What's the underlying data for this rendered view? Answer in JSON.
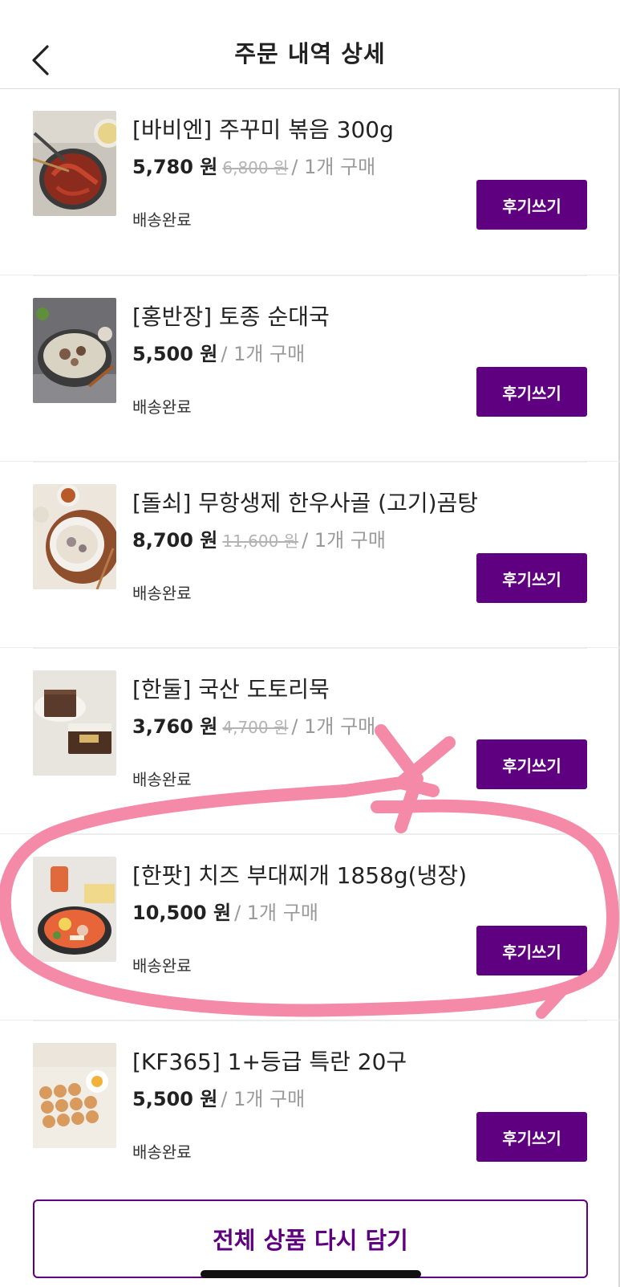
{
  "header": {
    "title": "주문 내역 상세"
  },
  "items": [
    {
      "name": "[바비엔] 주꾸미 볶음 300g",
      "price": "5,780 원",
      "original_price": "6,800 원",
      "quantity": "/ 1개 구매",
      "status": "배송완료",
      "review_label": "후기쓰기"
    },
    {
      "name": "[홍반장] 토종 순대국",
      "price": "5,500 원",
      "original_price": "",
      "quantity": "/ 1개 구매",
      "status": "배송완료",
      "review_label": "후기쓰기"
    },
    {
      "name": "[돌쇠] 무항생제 한우사골 (고기)곰탕",
      "price": "8,700 원",
      "original_price": "11,600 원",
      "quantity": "/ 1개 구매",
      "status": "배송완료",
      "review_label": "후기쓰기"
    },
    {
      "name": "[한둘] 국산 도토리묵",
      "price": "3,760 원",
      "original_price": "4,700 원",
      "quantity": "/ 1개 구매",
      "status": "배송완료",
      "review_label": "후기쓰기"
    },
    {
      "name": "[한팟] 치즈 부대찌개 1858g(냉장)",
      "price": "10,500 원",
      "original_price": "",
      "quantity": "/ 1개 구매",
      "status": "배송완료",
      "review_label": "후기쓰기"
    },
    {
      "name": "[KF365] 1+등급 특란 20구",
      "price": "5,500 원",
      "original_price": "",
      "quantity": "/ 1개 구매",
      "status": "배송완료",
      "review_label": "후기쓰기"
    }
  ],
  "reorder_label": "전체 상품 다시 담기",
  "colors": {
    "accent": "#5f0080",
    "annotation": "#f48aa8"
  }
}
